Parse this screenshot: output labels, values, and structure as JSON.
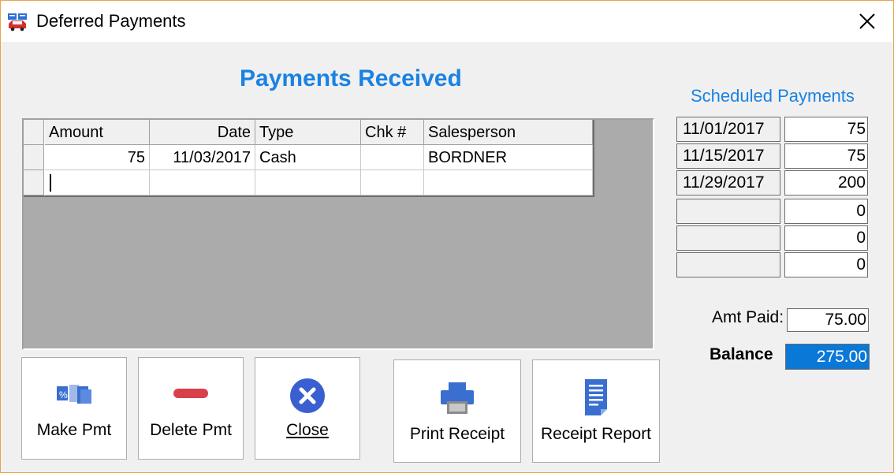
{
  "window": {
    "title": "Deferred Payments"
  },
  "heading": "Payments Received",
  "grid": {
    "columns": [
      "Amount",
      "Date",
      "Type",
      "Chk #",
      "Salesperson"
    ],
    "rows": [
      [
        "75",
        "11/03/2017",
        "Cash",
        "",
        "BORDNER"
      ],
      [
        "",
        "",
        "",
        "",
        ""
      ]
    ]
  },
  "scheduled": {
    "title": "Scheduled Payments",
    "rows": [
      {
        "date": "11/01/2017",
        "amount": "75"
      },
      {
        "date": "11/15/2017",
        "amount": "75"
      },
      {
        "date": "11/29/2017",
        "amount": "200"
      },
      {
        "date": "",
        "amount": "0"
      },
      {
        "date": "",
        "amount": "0"
      },
      {
        "date": "",
        "amount": "0"
      }
    ]
  },
  "totals": {
    "amt_paid_label": "Amt Paid:",
    "amt_paid": "75.00",
    "balance_label": "Balance",
    "balance": "275.00"
  },
  "buttons": {
    "make_pmt": "Make Pmt",
    "delete_pmt": "Delete Pmt",
    "close": "Close",
    "print_receipt": "Print Receipt",
    "receipt_report": "Receipt Report"
  },
  "colors": {
    "accent": "#1a82e2",
    "selection": "#0a78d7",
    "delete": "#d9404a"
  }
}
